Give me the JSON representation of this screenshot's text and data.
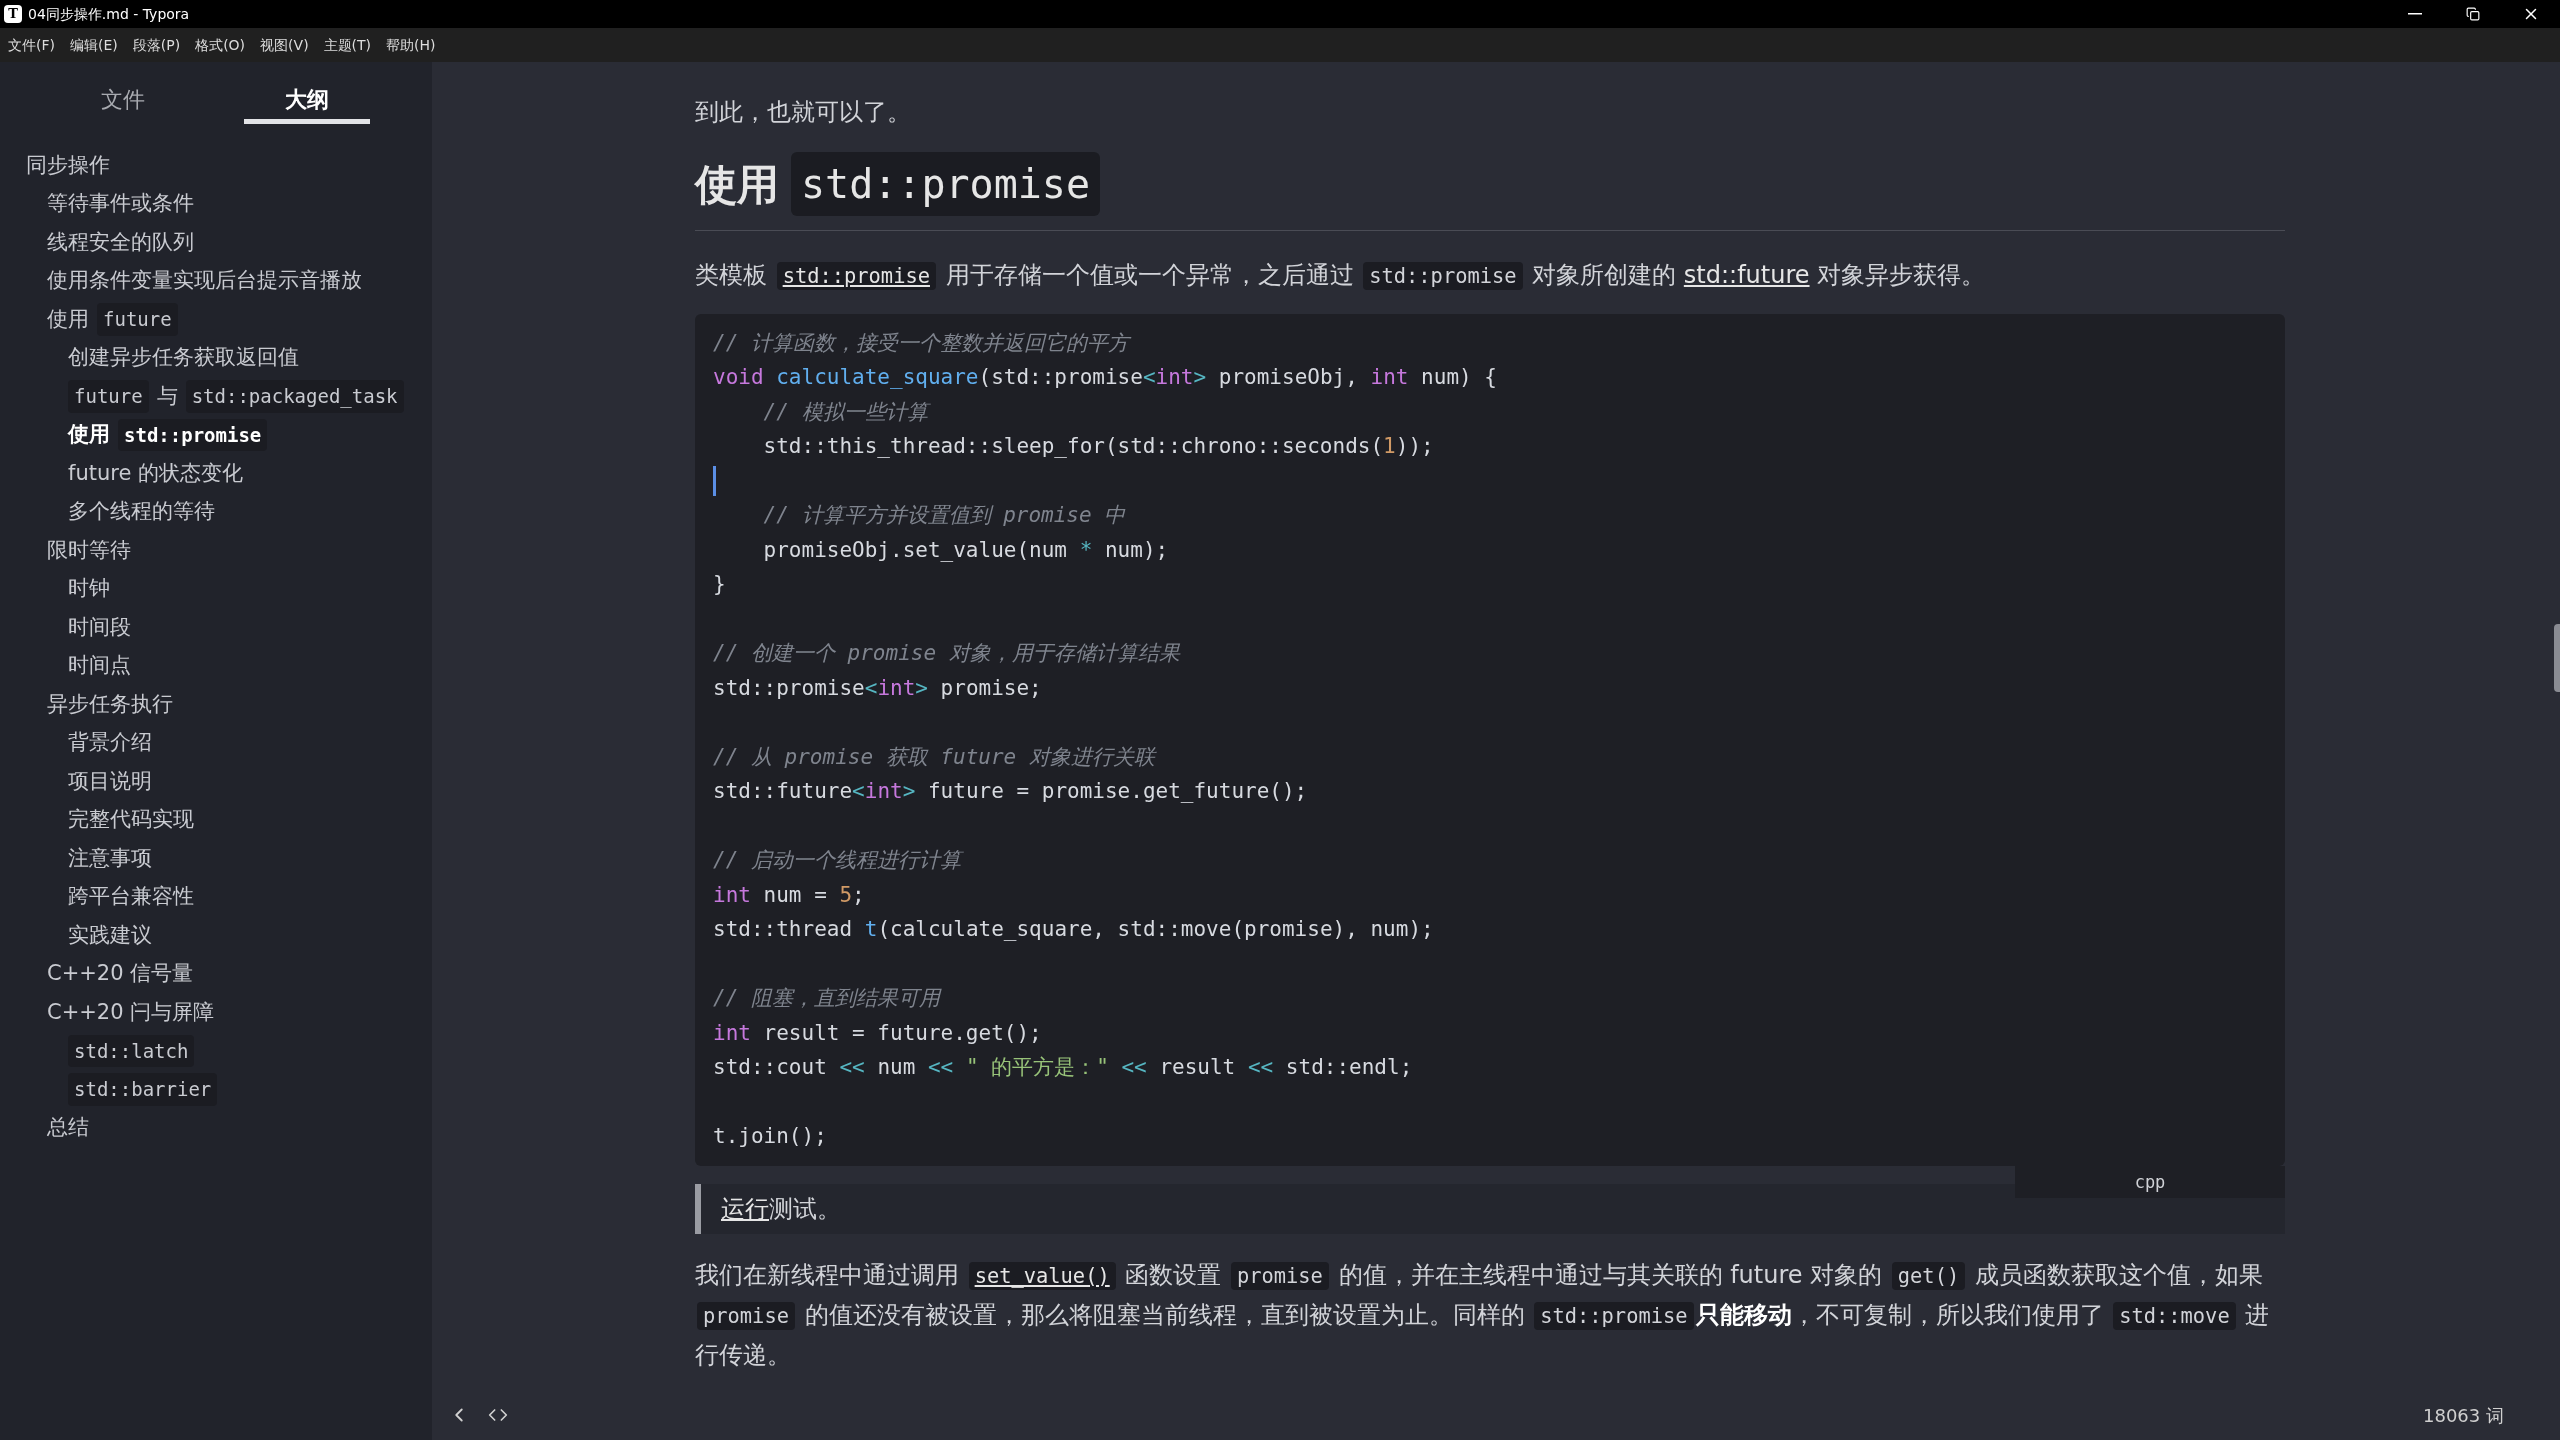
{
  "window": {
    "app_icon_letter": "T",
    "title": "04同步操作.md - Typora"
  },
  "menu": [
    "文件(F)",
    "编辑(E)",
    "段落(P)",
    "格式(O)",
    "视图(V)",
    "主题(T)",
    "帮助(H)"
  ],
  "sidebar": {
    "tabs": [
      {
        "label": "文件",
        "selected": false
      },
      {
        "label": "大纲",
        "selected": true
      }
    ],
    "outline": [
      {
        "parts": [
          {
            "kind": "text",
            "text": "同步操作"
          }
        ],
        "selected": false,
        "children": [
          {
            "parts": [
              {
                "kind": "text",
                "text": "等待事件或条件"
              }
            ],
            "selected": false
          },
          {
            "parts": [
              {
                "kind": "text",
                "text": "线程安全的队列"
              }
            ],
            "selected": false
          },
          {
            "parts": [
              {
                "kind": "text",
                "text": "使用条件变量实现后台提示音播放"
              }
            ],
            "selected": false
          },
          {
            "parts": [
              {
                "kind": "text",
                "text": "使用"
              },
              {
                "kind": "code",
                "text": "future"
              }
            ],
            "selected": false,
            "children": [
              {
                "parts": [
                  {
                    "kind": "text",
                    "text": "创建异步任务获取返回值"
                  }
                ],
                "selected": false
              },
              {
                "parts": [
                  {
                    "kind": "code",
                    "text": "future"
                  },
                  {
                    "kind": "text",
                    "text": "与"
                  },
                  {
                    "kind": "code",
                    "text": "std::packaged_task"
                  }
                ],
                "selected": false
              },
              {
                "parts": [
                  {
                    "kind": "text",
                    "text": "使用"
                  },
                  {
                    "kind": "code",
                    "text": "std::promise"
                  }
                ],
                "selected": true
              },
              {
                "parts": [
                  {
                    "kind": "text",
                    "text": "future 的状态变化"
                  }
                ],
                "selected": false
              },
              {
                "parts": [
                  {
                    "kind": "text",
                    "text": "多个线程的等待"
                  }
                ],
                "selected": false
              }
            ]
          },
          {
            "parts": [
              {
                "kind": "text",
                "text": "限时等待"
              }
            ],
            "selected": false,
            "children": [
              {
                "parts": [
                  {
                    "kind": "text",
                    "text": "时钟"
                  }
                ],
                "selected": false
              },
              {
                "parts": [
                  {
                    "kind": "text",
                    "text": "时间段"
                  }
                ],
                "selected": false
              },
              {
                "parts": [
                  {
                    "kind": "text",
                    "text": "时间点"
                  }
                ],
                "selected": false
              }
            ]
          },
          {
            "parts": [
              {
                "kind": "text",
                "text": "异步任务执行"
              }
            ],
            "selected": false,
            "children": [
              {
                "parts": [
                  {
                    "kind": "text",
                    "text": "背景介绍"
                  }
                ],
                "selected": false
              },
              {
                "parts": [
                  {
                    "kind": "text",
                    "text": "项目说明"
                  }
                ],
                "selected": false
              },
              {
                "parts": [
                  {
                    "kind": "text",
                    "text": "完整代码实现"
                  }
                ],
                "selected": false
              },
              {
                "parts": [
                  {
                    "kind": "text",
                    "text": "注意事项"
                  }
                ],
                "selected": false
              },
              {
                "parts": [
                  {
                    "kind": "text",
                    "text": "跨平台兼容性"
                  }
                ],
                "selected": false
              },
              {
                "parts": [
                  {
                    "kind": "text",
                    "text": "实践建议"
                  }
                ],
                "selected": false
              }
            ]
          },
          {
            "parts": [
              {
                "kind": "text",
                "text": "C++20 信号量"
              }
            ],
            "selected": false
          },
          {
            "parts": [
              {
                "kind": "text",
                "text": "C++20 闩与屏障"
              }
            ],
            "selected": false,
            "children": [
              {
                "parts": [
                  {
                    "kind": "code",
                    "text": "std::latch"
                  }
                ],
                "selected": false
              },
              {
                "parts": [
                  {
                    "kind": "code",
                    "text": "std::barrier"
                  }
                ],
                "selected": false
              }
            ]
          },
          {
            "parts": [
              {
                "kind": "text",
                "text": "总结"
              }
            ],
            "selected": false
          }
        ]
      }
    ]
  },
  "document": {
    "intro": "到此，也就可以了。",
    "heading": [
      {
        "kind": "text",
        "text": "使用"
      },
      {
        "kind": "code",
        "text": "std::promise"
      }
    ],
    "paragraph": [
      {
        "kind": "text",
        "text": "类模板 "
      },
      {
        "kind": "code_link",
        "text": "std::promise"
      },
      {
        "kind": "text",
        "text": " 用于存储一个值或一个异常，之后通过 "
      },
      {
        "kind": "code",
        "text": "std::promise"
      },
      {
        "kind": "text",
        "text": " 对象所创建的 "
      },
      {
        "kind": "link",
        "text": "std::future"
      },
      {
        "kind": "text",
        "text": " 对象异步获得。"
      }
    ],
    "code_block": {
      "language": "cpp",
      "lines": [
        {
          "tokens": [
            {
              "kind": "comment",
              "text": "// 计算函数，接受一个整数并返回它的平方"
            }
          ]
        },
        {
          "tokens": [
            {
              "kind": "keyword",
              "text": "void "
            },
            {
              "kind": "function",
              "text": "calculate_square"
            },
            {
              "kind": "plain",
              "text": "(std::promise"
            },
            {
              "kind": "operator",
              "text": "<"
            },
            {
              "kind": "keyword",
              "text": "int"
            },
            {
              "kind": "operator",
              "text": ">"
            },
            {
              "kind": "plain",
              "text": " promiseObj, "
            },
            {
              "kind": "keyword",
              "text": "int"
            },
            {
              "kind": "plain",
              "text": " num) {"
            }
          ]
        },
        {
          "tokens": [
            {
              "kind": "comment",
              "text": "    // 模拟一些计算"
            }
          ]
        },
        {
          "tokens": [
            {
              "kind": "plain",
              "text": "    std::this_thread::sleep_for(std::chrono::seconds("
            },
            {
              "kind": "number",
              "text": "1"
            },
            {
              "kind": "plain",
              "text": "));"
            }
          ]
        },
        {
          "kind": "caret"
        },
        {
          "tokens": [
            {
              "kind": "comment",
              "text": "    // 计算平方并设置值到 promise 中"
            }
          ]
        },
        {
          "tokens": [
            {
              "kind": "plain",
              "text": "    promiseObj.set_value(num "
            },
            {
              "kind": "operator",
              "text": "*"
            },
            {
              "kind": "plain",
              "text": " num);"
            }
          ]
        },
        {
          "tokens": [
            {
              "kind": "plain",
              "text": "}"
            }
          ]
        },
        {
          "kind": "blank"
        },
        {
          "tokens": [
            {
              "kind": "comment",
              "text": "// 创建一个 promise 对象，用于存储计算结果"
            }
          ]
        },
        {
          "tokens": [
            {
              "kind": "plain",
              "text": "std::promise"
            },
            {
              "kind": "operator",
              "text": "<"
            },
            {
              "kind": "keyword",
              "text": "int"
            },
            {
              "kind": "operator",
              "text": ">"
            },
            {
              "kind": "plain",
              "text": " promise;"
            }
          ]
        },
        {
          "kind": "blank"
        },
        {
          "tokens": [
            {
              "kind": "comment",
              "text": "// 从 promise 获取 future 对象进行关联"
            }
          ]
        },
        {
          "tokens": [
            {
              "kind": "plain",
              "text": "std::future"
            },
            {
              "kind": "operator",
              "text": "<"
            },
            {
              "kind": "keyword",
              "text": "int"
            },
            {
              "kind": "operator",
              "text": ">"
            },
            {
              "kind": "plain",
              "text": " future = promise.get_future();"
            }
          ]
        },
        {
          "kind": "blank"
        },
        {
          "tokens": [
            {
              "kind": "comment",
              "text": "// 启动一个线程进行计算"
            }
          ]
        },
        {
          "tokens": [
            {
              "kind": "keyword",
              "text": "int"
            },
            {
              "kind": "plain",
              "text": " num = "
            },
            {
              "kind": "number",
              "text": "5"
            },
            {
              "kind": "plain",
              "text": ";"
            }
          ]
        },
        {
          "tokens": [
            {
              "kind": "plain",
              "text": "std::thread "
            },
            {
              "kind": "function",
              "text": "t"
            },
            {
              "kind": "plain",
              "text": "(calculate_square, std::move(promise), num);"
            }
          ]
        },
        {
          "kind": "blank"
        },
        {
          "tokens": [
            {
              "kind": "comment",
              "text": "// 阻塞，直到结果可用"
            }
          ]
        },
        {
          "tokens": [
            {
              "kind": "keyword",
              "text": "int"
            },
            {
              "kind": "plain",
              "text": " result = future.get();"
            }
          ]
        },
        {
          "tokens": [
            {
              "kind": "plain",
              "text": "std::cout "
            },
            {
              "kind": "operator",
              "text": "<<"
            },
            {
              "kind": "plain",
              "text": " num "
            },
            {
              "kind": "operator",
              "text": "<<"
            },
            {
              "kind": "string",
              "text": " \" 的平方是：\" "
            },
            {
              "kind": "operator",
              "text": "<<"
            },
            {
              "kind": "plain",
              "text": " result "
            },
            {
              "kind": "operator",
              "text": "<<"
            },
            {
              "kind": "plain",
              "text": " std::endl;"
            }
          ]
        },
        {
          "kind": "blank"
        },
        {
          "tokens": [
            {
              "kind": "plain",
              "text": "t.join();"
            }
          ]
        }
      ]
    },
    "blockquote": [
      {
        "kind": "link",
        "text": "运行"
      },
      {
        "kind": "text",
        "text": "测试。"
      }
    ],
    "paragraph_2": [
      {
        "kind": "text",
        "text": "我们在新线程中通过调用 "
      },
      {
        "kind": "code_link",
        "text": "set_value()"
      },
      {
        "kind": "text",
        "text": " 函数设置 "
      },
      {
        "kind": "code",
        "text": "promise"
      },
      {
        "kind": "text",
        "text": " 的值，并在主线程中通过与其关联的 future 对象的 "
      },
      {
        "kind": "code",
        "text": "get()"
      },
      {
        "kind": "text",
        "text": " 成员函数获取这个值，如果 "
      },
      {
        "kind": "code",
        "text": "promise"
      },
      {
        "kind": "text",
        "text": " 的值还没有被设置，那么将阻塞当前线程，直到被设置为止。同样的 "
      },
      {
        "kind": "code",
        "text": "std::promise"
      },
      {
        "kind": "bold",
        "text": "只能移动"
      },
      {
        "kind": "text",
        "text": "，不可复制，所以我们使用了 "
      },
      {
        "kind": "code",
        "text": "std::move"
      },
      {
        "kind": "text",
        "text": " 进行传递。"
      }
    ]
  },
  "status_bar": {
    "word_count": "18063 词"
  }
}
